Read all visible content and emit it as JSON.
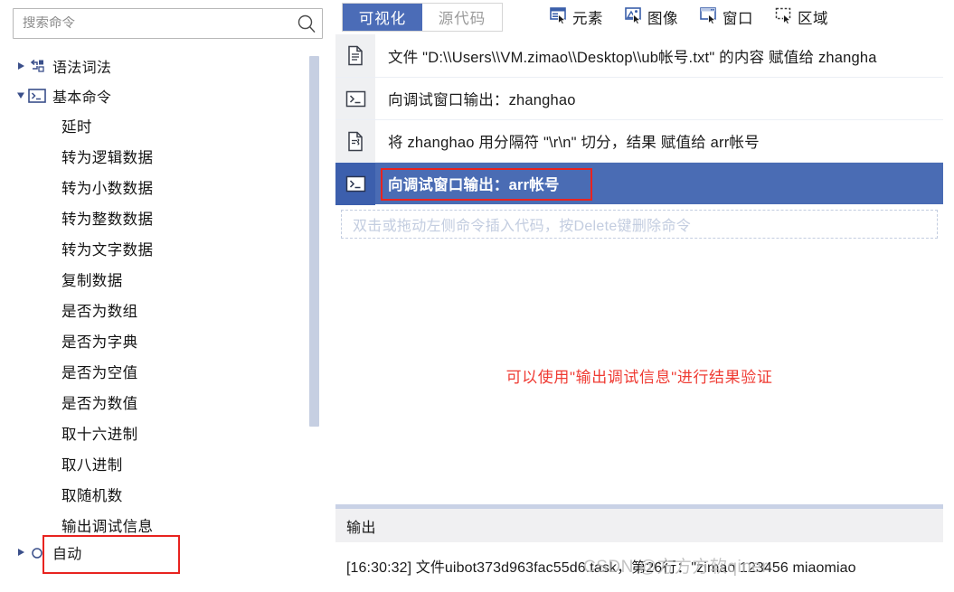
{
  "search": {
    "placeholder": "搜索命令",
    "value": "",
    "icon": "search-icon"
  },
  "sidebar": {
    "groups": [
      {
        "label": "语法词法",
        "expanded": false,
        "arrow": "▶",
        "icon": "flow-icon"
      },
      {
        "label": "基本命令",
        "expanded": true,
        "arrow": "▼",
        "icon": "console-icon"
      }
    ],
    "items": [
      "延时",
      "转为逻辑数据",
      "转为小数数据",
      "转为整数数据",
      "转为文字数据",
      "复制数据",
      "是否为数组",
      "是否为字典",
      "是否为空值",
      "是否为数值",
      "取十六进制",
      "取八进制",
      "取随机数",
      "输出调试信息"
    ],
    "highlighted_item": "输出调试信息",
    "bottom_partial": "自动"
  },
  "toolbar": {
    "tabs": [
      {
        "label": "可视化",
        "active": true
      },
      {
        "label": "源代码",
        "active": false
      }
    ],
    "tools": [
      {
        "label": "元素",
        "icon": "element-picker-icon"
      },
      {
        "label": "图像",
        "icon": "image-picker-icon"
      },
      {
        "label": "窗口",
        "icon": "window-picker-icon"
      },
      {
        "label": "区域",
        "icon": "region-picker-icon"
      }
    ]
  },
  "editor": {
    "rows": [
      {
        "icon": "file-icon",
        "text": "文件 \"D:\\\\Users\\\\VM.zimao\\\\Desktop\\\\ub帐号.txt\" 的内容 赋值给 zhangha",
        "selected": false
      },
      {
        "icon": "console-icon",
        "text": "向调试窗口输出：zhanghao",
        "selected": false
      },
      {
        "icon": "file-split-icon",
        "text": "将 zhanghao 用分隔符 \"\\r\\n\" 切分，结果 赋值给 arr帐号",
        "selected": false
      },
      {
        "icon": "console-icon",
        "text": "向调试窗口输出：arr帐号",
        "selected": true
      }
    ],
    "drop_hint": "双击或拖动左侧命令插入代码，按Delete键删除命令",
    "annotation": "可以使用\"输出调试信息\"进行结果验证"
  },
  "output": {
    "title": "输出",
    "lines": [
      "[16:30:32] 文件uibot373d963fac55d6.task，第26行：\"zimao 123456 miaomiao"
    ]
  },
  "watermark": "CSDN @方方方软qiner",
  "colors": {
    "accent": "#4b6cb7",
    "selected_row": "#4a6cb4",
    "highlight_box": "#e8231f",
    "annotation_red": "#ef3b33",
    "divider": "#c9d2e6",
    "row_icon_bg": "#eff0f2",
    "placeholder_gray": "#c3cde0"
  }
}
